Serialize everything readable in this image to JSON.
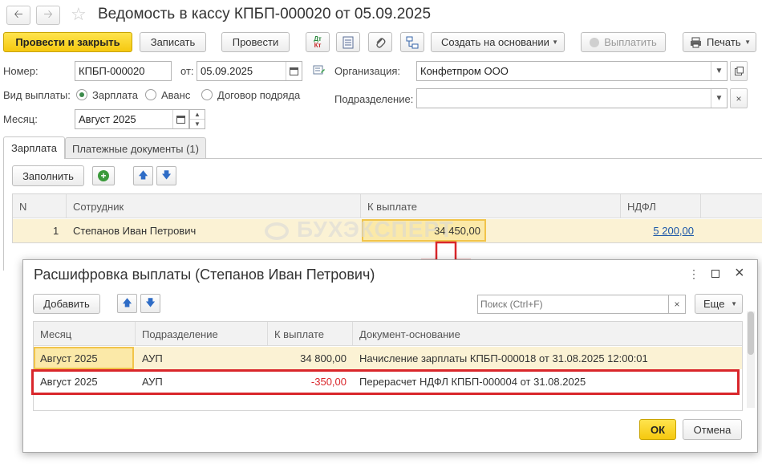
{
  "window": {
    "title": "Ведомость в кассу КПБП-000020 от 05.09.2025"
  },
  "toolbar": {
    "post_close": "Провести и закрыть",
    "save": "Записать",
    "post": "Провести",
    "create_based": "Создать на основании",
    "pay": "Выплатить",
    "print": "Печать",
    "dt_kt_line1": "Дт",
    "dt_kt_line2": "Кт"
  },
  "form": {
    "number_label": "Номер:",
    "number_value": "КПБП-000020",
    "date_label": "от:",
    "date_value": "05.09.2025",
    "org_label": "Организация:",
    "org_value": "Конфетпром ООО",
    "payment_type_label": "Вид выплаты:",
    "payment_options": [
      "Зарплата",
      "Аванс",
      "Договор подряда"
    ],
    "dept_label": "Подразделение:",
    "dept_value": "",
    "month_label": "Месяц:",
    "month_value": "Август 2025"
  },
  "tabs": {
    "salary": "Зарплата",
    "payment_docs": "Платежные документы (1)"
  },
  "salary_grid": {
    "fill_button": "Заполнить",
    "columns": [
      "N",
      "Сотрудник",
      "К выплате",
      "НДФЛ"
    ],
    "rows": [
      {
        "n": "1",
        "employee": "Степанов Иван Петрович",
        "to_pay": "34 450,00",
        "ndfl": "5 200,00"
      }
    ]
  },
  "watermark": "БУХЭКСПЕРТ",
  "dialog": {
    "title": "Расшифровка выплаты (Степанов Иван Петрович)",
    "add_button": "Добавить",
    "search_placeholder": "Поиск (Ctrl+F)",
    "more_button": "Еще",
    "columns": [
      "Месяц",
      "Подразделение",
      "К выплате",
      "Документ-основание"
    ],
    "rows": [
      {
        "month": "Август 2025",
        "dept": "АУП",
        "amount": "34 800,00",
        "doc": "Начисление зарплаты КПБП-000018 от 31.08.2025 12:00:01"
      },
      {
        "month": "Август 2025",
        "dept": "АУП",
        "amount": "-350,00",
        "doc": "Перерасчет НДФЛ КПБП-000004 от 31.08.2025"
      }
    ],
    "ok_button": "ОК",
    "cancel_button": "Отмена"
  },
  "colors": {
    "accent_yellow": "#f5c80f",
    "row_highlight": "#fbf2d4",
    "annotation_red": "#d9262b",
    "link_blue": "#1a55a8",
    "negative_red": "#d9262b"
  }
}
